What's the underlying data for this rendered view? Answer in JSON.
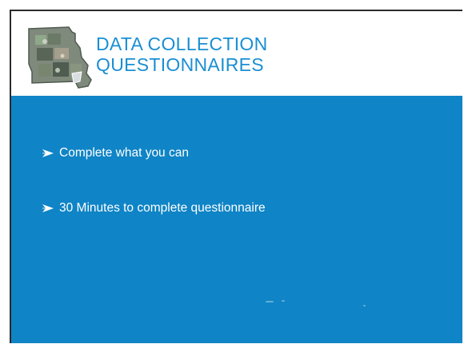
{
  "slide": {
    "title_line1": "DATA COLLECTION",
    "title_line2": "QUESTIONNAIRES",
    "logo_icon": "missouri-map-icon",
    "bullets": [
      "Complete what you can",
      "30 Minutes to complete questionnaire"
    ]
  },
  "colors": {
    "title": "#1a8fd2",
    "panel": "#0f84c6",
    "bullet_text": "#ffffff"
  }
}
